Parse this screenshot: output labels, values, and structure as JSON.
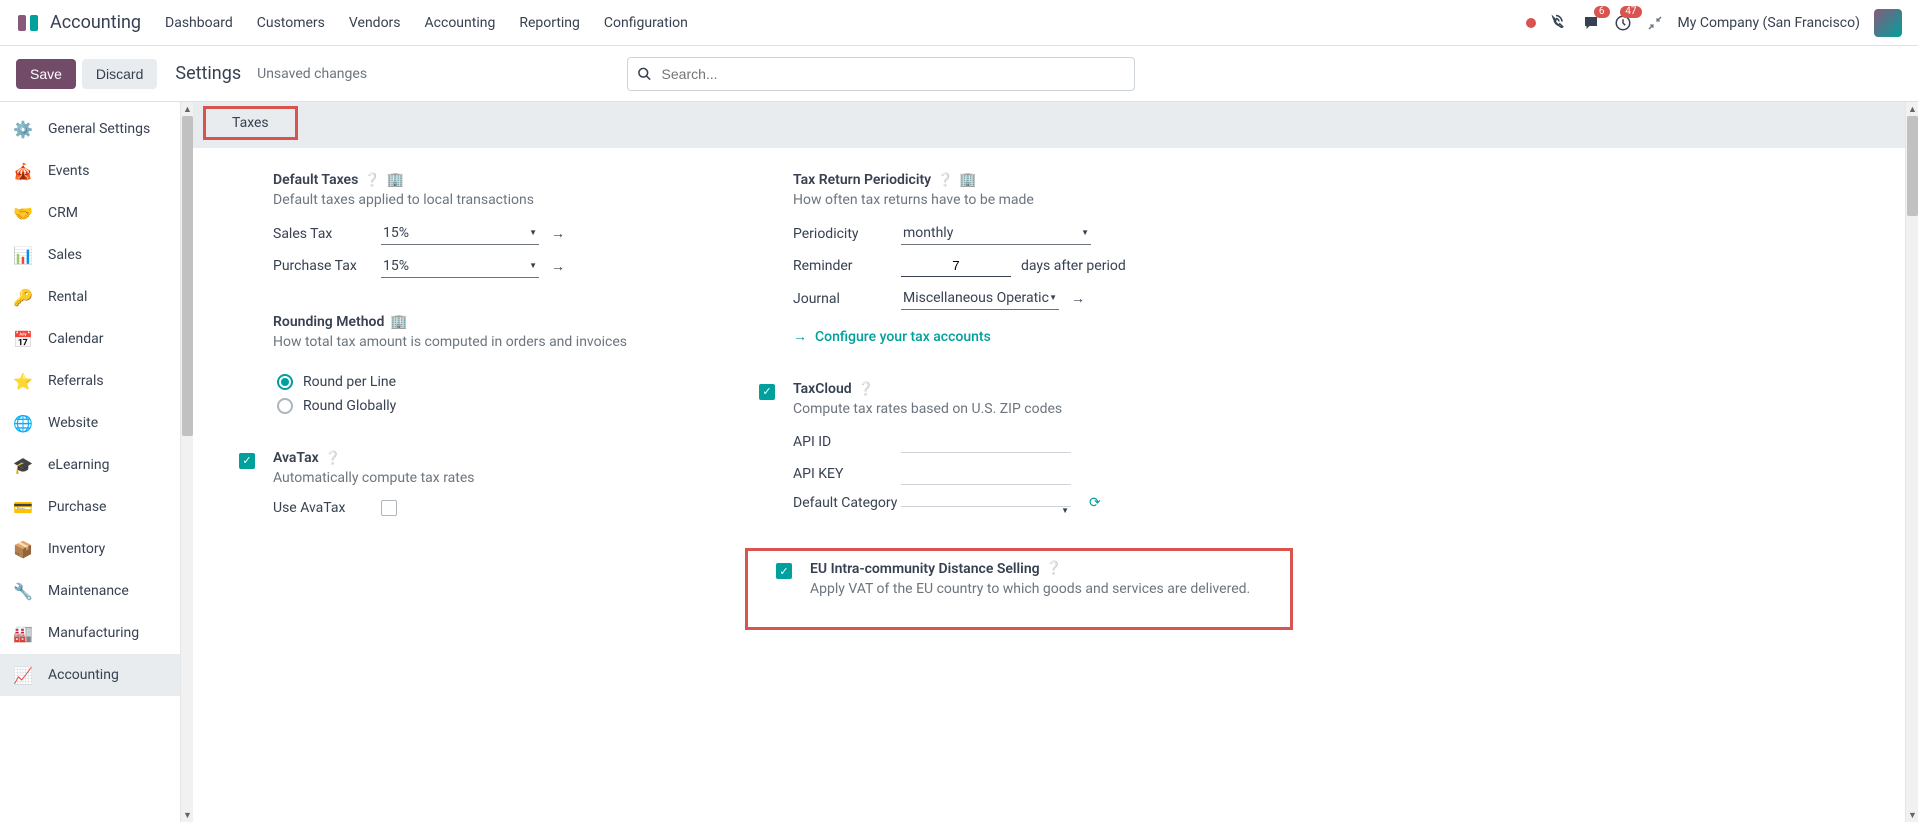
{
  "topnav": {
    "app_name": "Accounting",
    "menu": [
      "Dashboard",
      "Customers",
      "Vendors",
      "Accounting",
      "Reporting",
      "Configuration"
    ],
    "messages_badge": "6",
    "activities_badge": "47",
    "company": "My Company (San Francisco)"
  },
  "controlbar": {
    "save": "Save",
    "discard": "Discard",
    "breadcrumb": "Settings",
    "unsaved": "Unsaved changes",
    "search_placeholder": "Search..."
  },
  "sidebar": {
    "items": [
      {
        "label": "General Settings",
        "icon": "⚙️",
        "color": "#875A7B"
      },
      {
        "label": "Events",
        "icon": "🎪",
        "color": "#f0ad4e"
      },
      {
        "label": "CRM",
        "icon": "🤝",
        "color": "#17a2b8"
      },
      {
        "label": "Sales",
        "icon": "📊",
        "color": "#d9534f"
      },
      {
        "label": "Rental",
        "icon": "🔑",
        "color": "#5bc0de"
      },
      {
        "label": "Calendar",
        "icon": "📅",
        "color": "#f0ad4e"
      },
      {
        "label": "Referrals",
        "icon": "⭐",
        "color": "#d9534f"
      },
      {
        "label": "Website",
        "icon": "🌐",
        "color": "#00A09D"
      },
      {
        "label": "eLearning",
        "icon": "🎓",
        "color": "#875A7B"
      },
      {
        "label": "Purchase",
        "icon": "💳",
        "color": "#5e8e3e"
      },
      {
        "label": "Inventory",
        "icon": "📦",
        "color": "#f0ad4e"
      },
      {
        "label": "Maintenance",
        "icon": "🔧",
        "color": "#1f77b4"
      },
      {
        "label": "Manufacturing",
        "icon": "🏭",
        "color": "#6c757d"
      },
      {
        "label": "Accounting",
        "icon": "📈",
        "color": "#714B67",
        "active": true
      }
    ]
  },
  "section_title": "Taxes",
  "default_taxes": {
    "title": "Default Taxes",
    "desc": "Default taxes applied to local transactions",
    "sales_label": "Sales Tax",
    "sales_value": "15%",
    "purchase_label": "Purchase Tax",
    "purchase_value": "15%"
  },
  "tax_return": {
    "title": "Tax Return Periodicity",
    "desc": "How often tax returns have to be made",
    "periodicity_label": "Periodicity",
    "periodicity_value": "monthly",
    "reminder_label": "Reminder",
    "reminder_value": "7",
    "reminder_suffix": "days after period",
    "journal_label": "Journal",
    "journal_value": "Miscellaneous Operatic",
    "config_link": "Configure your tax accounts"
  },
  "rounding": {
    "title": "Rounding Method",
    "desc": "How total tax amount is computed in orders and invoices",
    "opt1": "Round per Line",
    "opt2": "Round Globally"
  },
  "taxcloud": {
    "title": "TaxCloud",
    "desc": "Compute tax rates based on U.S. ZIP codes",
    "api_id_label": "API ID",
    "api_key_label": "API KEY",
    "default_cat_label": "Default Category"
  },
  "avatax": {
    "title": "AvaTax",
    "desc": "Automatically compute tax rates",
    "use_label": "Use AvaTax"
  },
  "eu_distance": {
    "title": "EU Intra-community Distance Selling",
    "desc": "Apply VAT of the EU country to which goods and services are delivered."
  }
}
